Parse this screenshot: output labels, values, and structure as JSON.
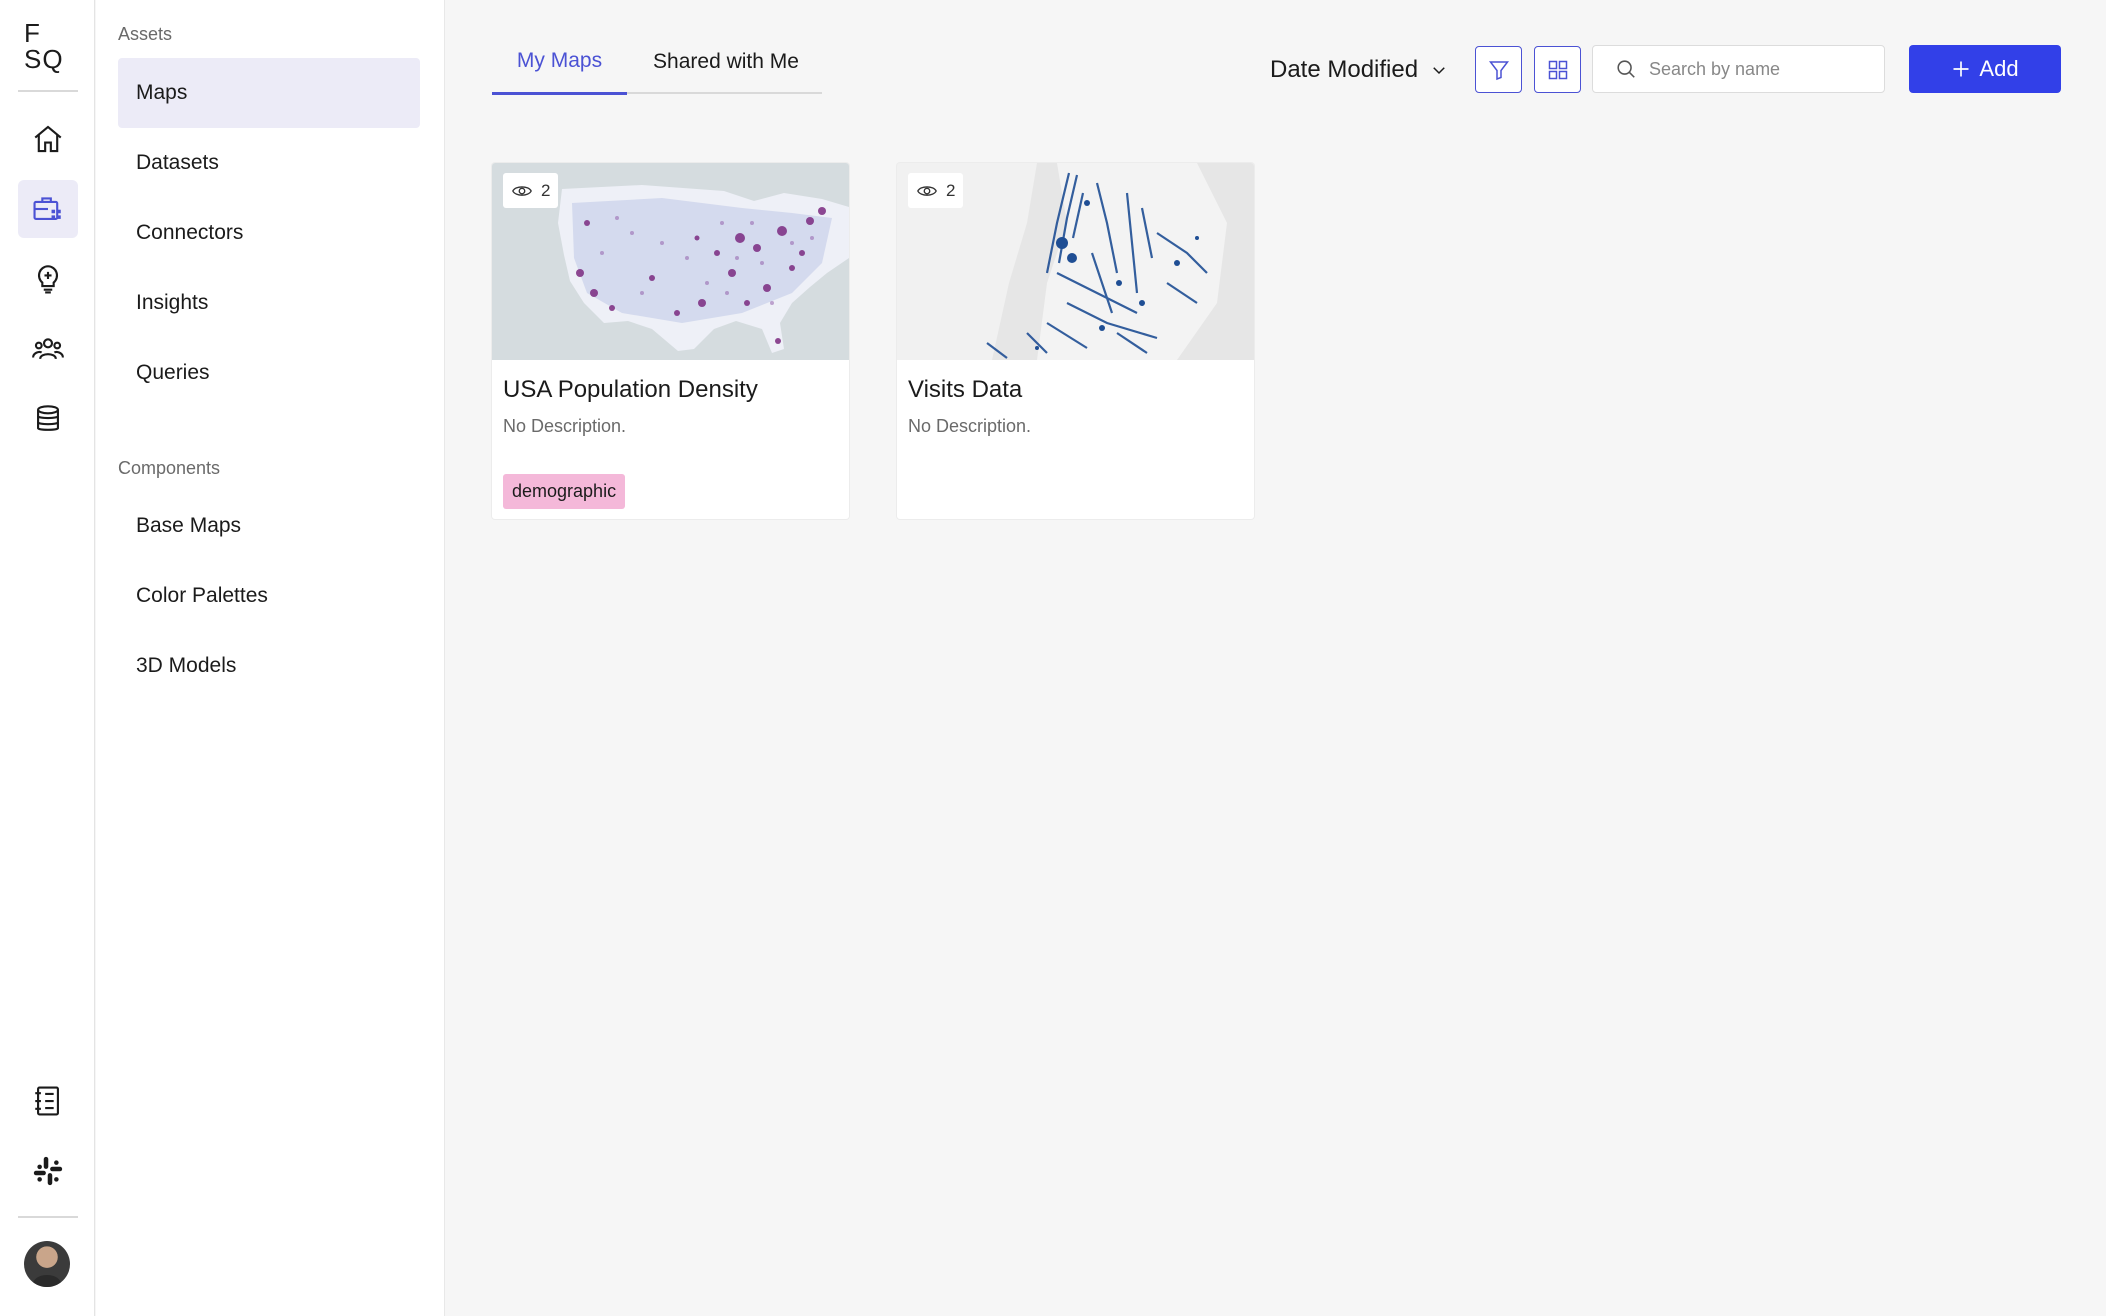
{
  "logo": {
    "line1": "F",
    "line2": "SQ"
  },
  "rail": {
    "items": [
      {
        "icon": "home-icon"
      },
      {
        "icon": "briefcase-grid-icon",
        "active": true
      },
      {
        "icon": "lightbulb-icon"
      },
      {
        "icon": "users-icon"
      },
      {
        "icon": "database-icon"
      }
    ],
    "bottom": [
      {
        "icon": "notebook-icon"
      },
      {
        "icon": "slack-icon"
      }
    ],
    "avatar": "user-avatar"
  },
  "sidebar": {
    "assets_label": "Assets",
    "assets": [
      {
        "label": "Maps",
        "active": true
      },
      {
        "label": "Datasets"
      },
      {
        "label": "Connectors"
      },
      {
        "label": "Insights"
      },
      {
        "label": "Queries"
      }
    ],
    "components_label": "Components",
    "components": [
      {
        "label": "Base Maps"
      },
      {
        "label": "Color Palettes"
      },
      {
        "label": "3D Models"
      }
    ]
  },
  "tabs": [
    {
      "label": "My Maps",
      "active": true
    },
    {
      "label": "Shared with Me"
    }
  ],
  "toolbar": {
    "sort_label": "Date Modified",
    "search_placeholder": "Search by name",
    "add_label": "Add"
  },
  "maps": [
    {
      "title": "USA Population Density",
      "description": "No Description.",
      "views": "2",
      "tag": "demographic"
    },
    {
      "title": "Visits Data",
      "description": "No Description.",
      "views": "2"
    }
  ],
  "colors": {
    "accent": "#4b52d4",
    "primary_button": "#3240e8",
    "active_nav_bg": "#ecebf7",
    "tag_bg": "#f4b8d9",
    "page_bg": "#f6f6f6"
  }
}
